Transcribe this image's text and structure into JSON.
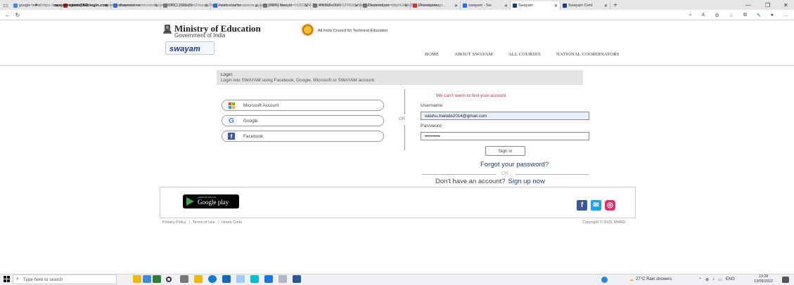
{
  "browser": {
    "tabs": [
      {
        "title": "google transl",
        "color": "#4285f4",
        "active": false
      },
      {
        "title": "Inbox (346) -",
        "color": "#c5221f",
        "active": false
      },
      {
        "title": "dharwate na",
        "color": "#1a73e8",
        "active": false
      },
      {
        "title": "DNC 2020-21",
        "color": "#777777",
        "active": false
      },
      {
        "title": "mooc course",
        "color": "#1a73e8",
        "active": false
      },
      {
        "title": "[PDF] Massiv",
        "color": "#777777",
        "active": false
      },
      {
        "title": "4ffc6b5c0ce1",
        "color": "#777777",
        "active": false
      },
      {
        "title": "Dissertation",
        "color": "#777777",
        "active": false
      },
      {
        "title": "Dissertation",
        "color": "#d93025",
        "active": false
      },
      {
        "title": "swayam - Sw",
        "color": "#1a73e8",
        "active": false
      },
      {
        "title": "Swayam",
        "color": "#1e3a8a",
        "active": true
      },
      {
        "title": "Swayam Cent",
        "color": "#1e3a8a",
        "active": false
      }
    ],
    "url_prefix": "https://",
    "url_domain": "swayamopenid.b2clogin.com",
    "url_rest": "/swayamopenid.onmicrosoft.com/B2C_1_swayam2/oauth2/v2.0/authorize?response_type=code&client_id=019220f4-2ec0-41c2-a727-529f1b54bb06&redirect_uri=http%3A%2F%2Fswayam.go..."
  },
  "header": {
    "ministry_title": "Ministry of Education",
    "ministry_sub": "Government of India",
    "aicte_text": "All India Council for Technical Education",
    "logo_word": "swayam",
    "nav": [
      "HOME",
      "ABOUT SWAYAM",
      "ALL COURSES",
      "NATIONAL COORDINATORS"
    ]
  },
  "login": {
    "heading": "Login:",
    "subheading": "Login into SWAYAM using Facebook, Google, Microsoft or SWAYAM account.",
    "microsoft_label": "Microsoft Account",
    "google_label": "Google",
    "facebook_label": "Facebook",
    "or_label": "OR",
    "error": "We can't seem to find your account",
    "username_label": "Username",
    "username_value": "vaishu.malode2014@gmail.com",
    "password_label": "Password",
    "password_value": "••••••••••",
    "signin_label": "Sign in",
    "forgot_label": "Forgot your password?",
    "or2_label": "OR",
    "no_account_label": "Don't have an account?",
    "signup_label": "Sign up now"
  },
  "footer": {
    "store_small": "ANDROID APP ON",
    "store_label": "Google play",
    "links": [
      "Privacy Policy",
      "Terms of Use",
      "Honor Code"
    ],
    "copyright": "Copyright © 2020, MHRD"
  },
  "taskbar": {
    "search_placeholder": "Type here to search",
    "weather": "27°C  Rain showers",
    "lang": "ENG",
    "time": "13:28",
    "date": "13/09/2022"
  },
  "colors": {
    "link_blue": "#1a3c8c",
    "error_red": "#c0392b",
    "facebook_blue": "#3b5998",
    "twitter_blue": "#1da1f2",
    "instagram": "#e1306c"
  },
  "icons": [
    "windows-icon",
    "microsoft-logo-icon",
    "google-logo-icon",
    "facebook-logo-icon",
    "twitter-logo-icon",
    "instagram-logo-icon",
    "google-play-icon",
    "search-icon",
    "lock-icon"
  ]
}
